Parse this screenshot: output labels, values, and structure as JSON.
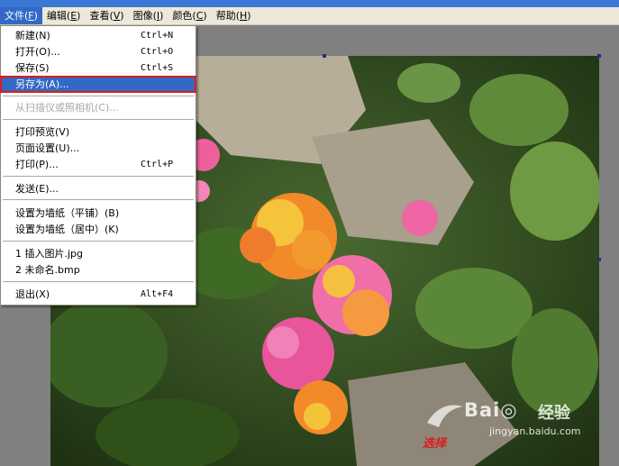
{
  "menubar": {
    "items": [
      {
        "label": "文件(",
        "mnemonic": "F",
        "tail": ")"
      },
      {
        "label": "编辑(",
        "mnemonic": "E",
        "tail": ")"
      },
      {
        "label": "查看(",
        "mnemonic": "V",
        "tail": ")"
      },
      {
        "label": "图像(",
        "mnemonic": "I",
        "tail": ")"
      },
      {
        "label": "颜色(",
        "mnemonic": "C",
        "tail": ")"
      },
      {
        "label": "帮助(",
        "mnemonic": "H",
        "tail": ")"
      }
    ]
  },
  "file_menu": {
    "items": [
      {
        "label": "新建(N)",
        "shortcut": "Ctrl+N"
      },
      {
        "label": "打开(O)...",
        "shortcut": "Ctrl+O"
      },
      {
        "label": "保存(S)",
        "shortcut": "Ctrl+S"
      },
      {
        "label": "另存为(A)...",
        "shortcut": ""
      },
      {
        "label": "从扫描仪或照相机(C)...",
        "shortcut": ""
      },
      {
        "label": "打印预览(V)",
        "shortcut": ""
      },
      {
        "label": "页面设置(U)...",
        "shortcut": ""
      },
      {
        "label": "打印(P)...",
        "shortcut": "Ctrl+P"
      },
      {
        "label": "发送(E)...",
        "shortcut": ""
      },
      {
        "label": "设置为墙纸（平铺）(B)",
        "shortcut": ""
      },
      {
        "label": "设置为墙纸（居中）(K)",
        "shortcut": ""
      },
      {
        "label": "1 插入图片.jpg",
        "shortcut": ""
      },
      {
        "label": "2 未命名.bmp",
        "shortcut": ""
      },
      {
        "label": "退出(X)",
        "shortcut": "Alt+F4"
      }
    ]
  },
  "watermark": {
    "logo": "Bai◎",
    "jingyan": "经验",
    "url": "jingyan.baidu.com",
    "caption": "选择"
  },
  "colors": {
    "menu_highlight": "#316ac5",
    "highlight_border": "#e01b1b",
    "menubar_bg": "#ece9d8",
    "canvas_bg": "#808080"
  }
}
